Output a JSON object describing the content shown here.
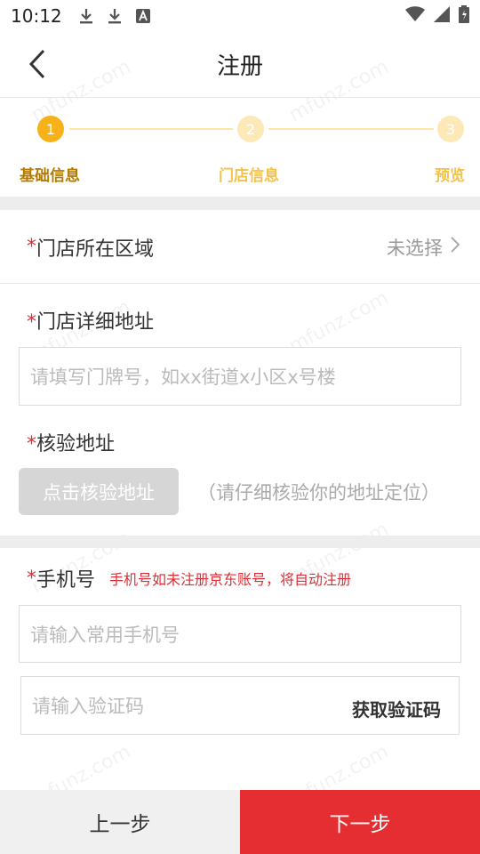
{
  "status_bar": {
    "time": "10:12",
    "icons": [
      "download-icon",
      "download-icon",
      "font-a-icon"
    ],
    "right_icons": [
      "wifi-icon",
      "signal-icon",
      "battery-icon"
    ]
  },
  "nav": {
    "title": "注册",
    "back_icon": "chevron-left-icon"
  },
  "stepper": {
    "steps": [
      {
        "number": "1",
        "label": "基础信息",
        "state": "active"
      },
      {
        "number": "2",
        "label": "门店信息",
        "state": "inactive"
      },
      {
        "number": "3",
        "label": "预览",
        "state": "inactive"
      }
    ],
    "accent": "#f7b21b"
  },
  "form": {
    "required_mark": "*",
    "region": {
      "label": "门店所在区域",
      "value": "未选择"
    },
    "address": {
      "label": "门店详细地址",
      "placeholder": "请填写门牌号，如xx街道x小区x号楼"
    },
    "verify": {
      "label": "核验地址",
      "button": "点击核验地址",
      "hint": "（请仔细核验你的地址定位）"
    },
    "phone": {
      "label": "手机号",
      "tip": "手机号如未注册京东账号，将自动注册",
      "placeholder": "请输入常用手机号"
    },
    "code": {
      "placeholder": "请输入验证码",
      "button": "获取验证码"
    }
  },
  "footer": {
    "prev": "上一步",
    "next": "下一步",
    "next_color": "#e52e32"
  },
  "watermark": "mfunz.com"
}
